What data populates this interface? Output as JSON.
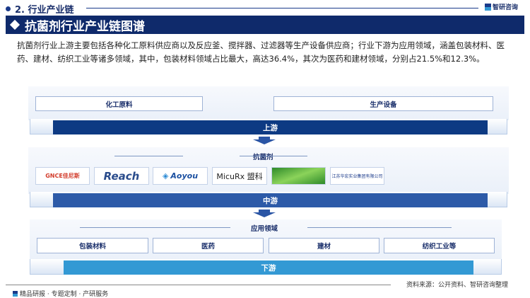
{
  "section": {
    "title": "2. 行业产业链"
  },
  "brand": {
    "name": "智研咨询"
  },
  "banner": {
    "title": "抗菌剂行业产业链图谱"
  },
  "description": "抗菌剂行业上游主要包括各种化工原料供应商以及反应釜、搅拌器、过滤器等生产设备供应商；行业下游为应用领域，涵盖包装材料、医药、建材、纺织工业等诸多领域，其中，包装材料领域占比最大，高达36.4%，其次为医药和建材领域，分别占21.5%和12.3%。",
  "upstream": {
    "items": [
      "化工原料",
      "生产设备"
    ],
    "bar": "上游"
  },
  "midstream": {
    "label": "抗菌剂",
    "bar": "中游",
    "logos": [
      "GNCE佳尼斯",
      "Reach",
      "Aoyou",
      "MicuRx 盟科",
      "",
      "江苏华宏实业集团有限公司"
    ]
  },
  "downstream": {
    "label": "应用领域",
    "items": [
      "包装材料",
      "医药",
      "建材",
      "纺织工业等"
    ],
    "bar": "下游"
  },
  "footer": {
    "tagline": "精品研报 · 专题定制 · 产研服务",
    "source": "资料来源：公开资料、智研咨询整理"
  },
  "colors": {
    "upstream": "#0d3a83",
    "midstream": "#2d5aa8",
    "downstream": "#3399d4",
    "banner": "#0f2a6b"
  }
}
